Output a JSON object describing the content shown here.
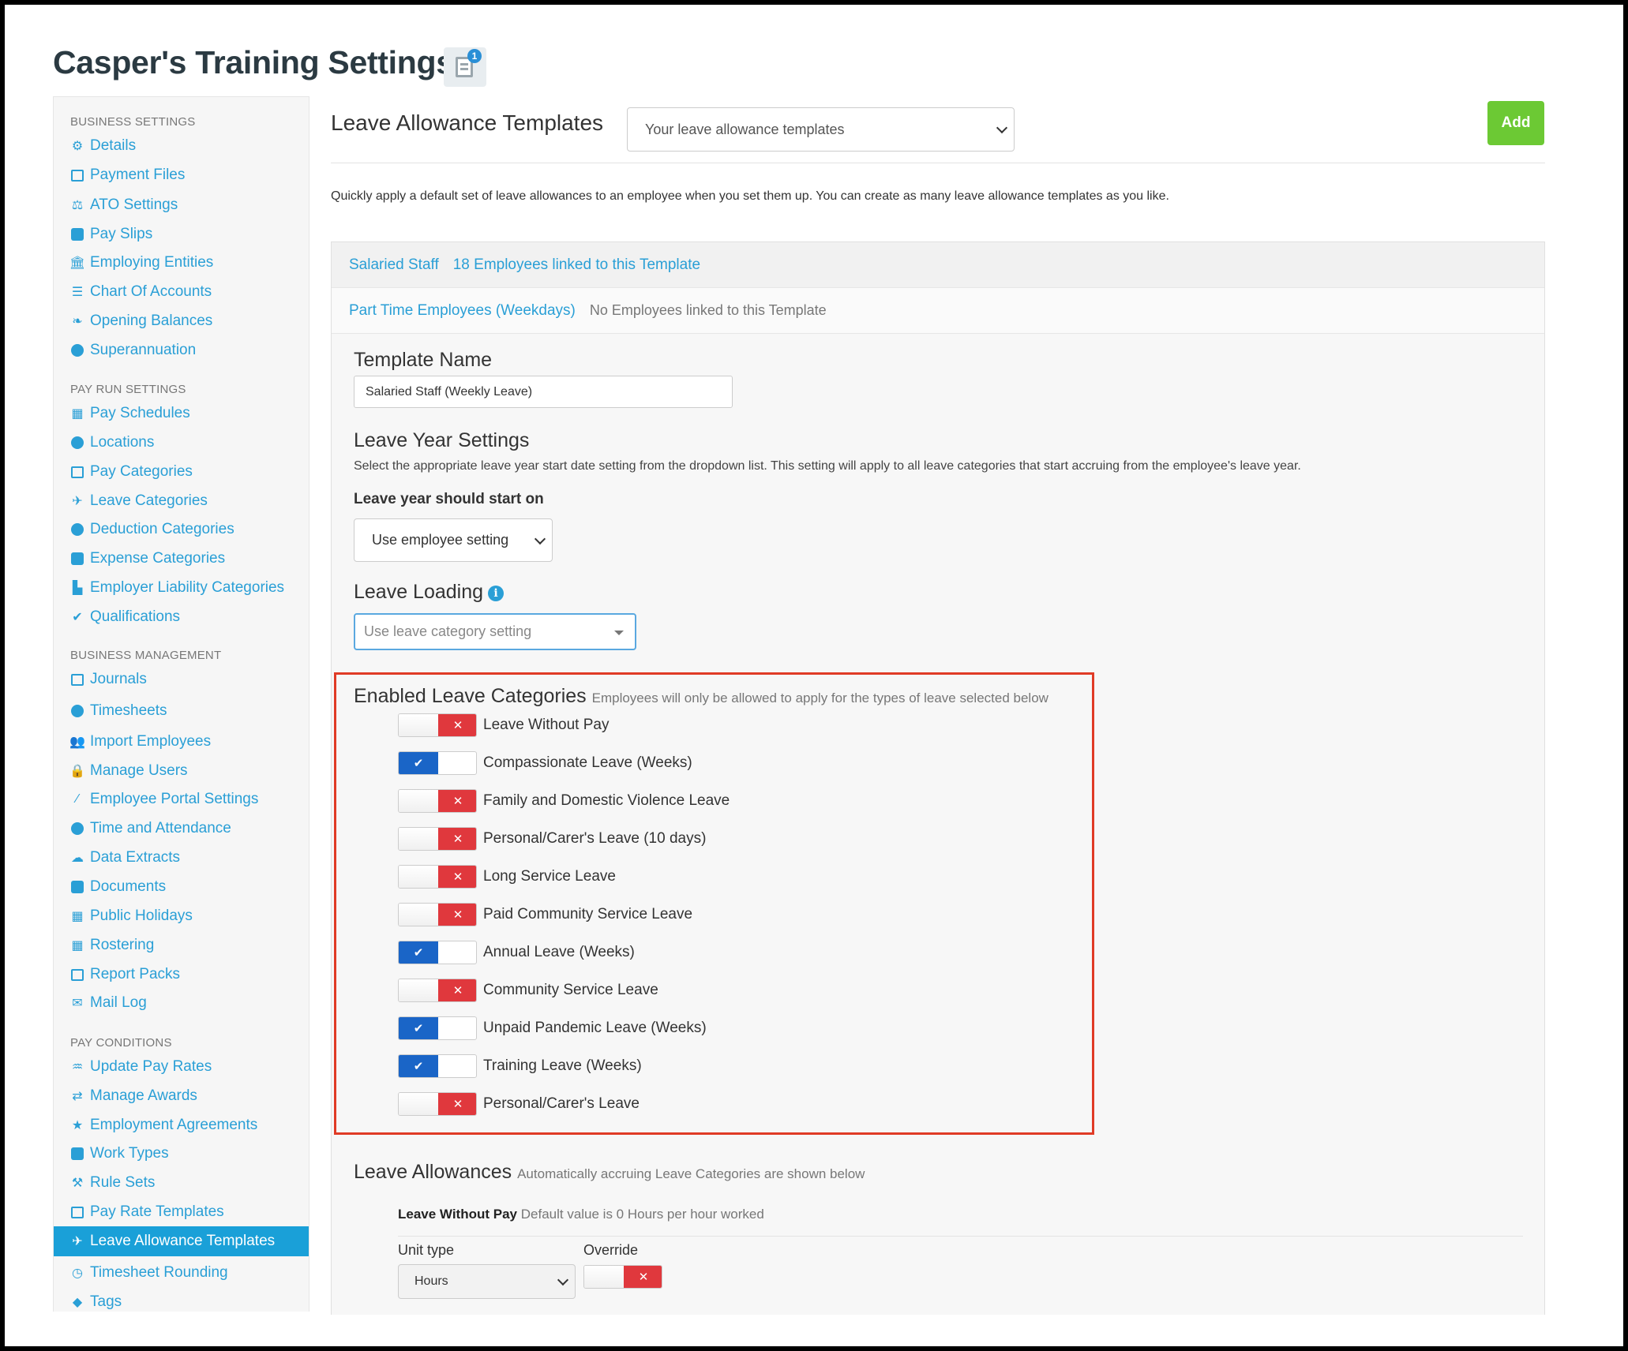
{
  "page": {
    "title": "Casper's Training Settings",
    "notification_count": "1"
  },
  "sidebar": {
    "sections": [
      {
        "heading": "BUSINESS SETTINGS"
      },
      {
        "heading": "PAY RUN SETTINGS"
      },
      {
        "heading": "BUSINESS MANAGEMENT"
      },
      {
        "heading": "PAY CONDITIONS"
      }
    ],
    "items": [
      {
        "label": "Details",
        "icon": "gear-icon"
      },
      {
        "label": "Payment Files",
        "icon": "save-icon"
      },
      {
        "label": "ATO Settings",
        "icon": "balance-scale-icon"
      },
      {
        "label": "Pay Slips",
        "icon": "file-icon"
      },
      {
        "label": "Employing Entities",
        "icon": "institution-icon"
      },
      {
        "label": "Chart Of Accounts",
        "icon": "list-icon"
      },
      {
        "label": "Opening Balances",
        "icon": "leaf-icon"
      },
      {
        "label": "Superannuation",
        "icon": "lifebuoy-icon"
      },
      {
        "label": "Pay Schedules",
        "icon": "calendar-icon"
      },
      {
        "label": "Locations",
        "icon": "globe-icon"
      },
      {
        "label": "Pay Categories",
        "icon": "money-icon"
      },
      {
        "label": "Leave Categories",
        "icon": "plane-icon"
      },
      {
        "label": "Deduction Categories",
        "icon": "minus-circle-icon"
      },
      {
        "label": "Expense Categories",
        "icon": "archive-icon"
      },
      {
        "label": "Employer Liability Categories",
        "icon": "bar-chart-icon"
      },
      {
        "label": "Qualifications",
        "icon": "check-icon"
      },
      {
        "label": "Journals",
        "icon": "columns-icon"
      },
      {
        "label": "Timesheets",
        "icon": "clock-icon"
      },
      {
        "label": "Import Employees",
        "icon": "users-icon"
      },
      {
        "label": "Manage Users",
        "icon": "lock-icon"
      },
      {
        "label": "Employee Portal Settings",
        "icon": "magic-wand-icon"
      },
      {
        "label": "Time and Attendance",
        "icon": "stopwatch-icon"
      },
      {
        "label": "Data Extracts",
        "icon": "cloud-download-icon"
      },
      {
        "label": "Documents",
        "icon": "folder-icon"
      },
      {
        "label": "Public Holidays",
        "icon": "calendar-icon"
      },
      {
        "label": "Rostering",
        "icon": "calendar-grid-icon"
      },
      {
        "label": "Report Packs",
        "icon": "folder-open-icon"
      },
      {
        "label": "Mail Log",
        "icon": "envelope-icon"
      },
      {
        "label": "Update Pay Rates",
        "icon": "hand-money-icon"
      },
      {
        "label": "Manage Awards",
        "icon": "exchange-icon"
      },
      {
        "label": "Employment Agreements",
        "icon": "star-icon"
      },
      {
        "label": "Work Types",
        "icon": "camera-icon"
      },
      {
        "label": "Rule Sets",
        "icon": "gavel-icon"
      },
      {
        "label": "Pay Rate Templates",
        "icon": "money-icon"
      },
      {
        "label": "Leave Allowance Templates",
        "icon": "plane-icon",
        "active": true
      },
      {
        "label": "Timesheet Rounding",
        "icon": "clock-outline-icon"
      },
      {
        "label": "Tags",
        "icon": "tag-icon"
      }
    ]
  },
  "main": {
    "heading": "Leave Allowance Templates",
    "template_select": "Your leave allowance templates",
    "add_label": "Add",
    "intro": "Quickly apply a default set of leave allowances to an employee when you set them up. You can create as many leave allowance templates as you like.",
    "templates": [
      {
        "name": "Salaried Staff",
        "link_text": "18 Employees linked to this Template"
      },
      {
        "name": "Part Time Employees (Weekdays)",
        "link_text": "No Employees linked to this Template"
      }
    ],
    "template_name_heading": "Template Name",
    "template_name_value": "Salaried Staff (Weekly Leave)",
    "leave_year_heading": "Leave Year Settings",
    "leave_year_desc": "Select the appropriate leave year start date setting from the dropdown list. This setting will apply to all leave categories that start accruing from the employee's leave year.",
    "leave_year_label": "Leave year should start on",
    "leave_year_value": "Use employee setting",
    "leave_loading_heading": "Leave Loading",
    "leave_loading_value": "Use leave category setting",
    "enabled_heading": "Enabled Leave Categories",
    "enabled_sub": "Employees will only be allowed to apply for the types of leave selected below",
    "categories": [
      {
        "label": "Leave Without Pay",
        "enabled": false
      },
      {
        "label": "Compassionate Leave (Weeks)",
        "enabled": true
      },
      {
        "label": "Family and Domestic Violence Leave",
        "enabled": false
      },
      {
        "label": "Personal/Carer's Leave (10 days)",
        "enabled": false
      },
      {
        "label": "Long Service Leave",
        "enabled": false
      },
      {
        "label": "Paid Community Service Leave",
        "enabled": false
      },
      {
        "label": "Annual Leave (Weeks)",
        "enabled": true
      },
      {
        "label": "Community Service Leave",
        "enabled": false
      },
      {
        "label": "Unpaid Pandemic Leave (Weeks)",
        "enabled": true
      },
      {
        "label": "Training Leave (Weeks)",
        "enabled": true
      },
      {
        "label": "Personal/Carer's Leave",
        "enabled": false
      }
    ],
    "allowances_heading": "Leave Allowances",
    "allowances_sub": "Automatically accruing Leave Categories are shown below",
    "lwp_title": "Leave Without Pay",
    "lwp_sub": "Default value is 0 Hours per hour worked",
    "unit_type_label": "Unit type",
    "unit_type_value": "Hours",
    "override_label": "Override",
    "override_enabled": false
  },
  "colors": {
    "link": "#2a9fd6",
    "add_button": "#6cc934",
    "toggle_on": "#1a65c7",
    "toggle_off": "#e0383d",
    "highlight_box": "#e03b26",
    "active_nav": "#1aa0d8"
  }
}
